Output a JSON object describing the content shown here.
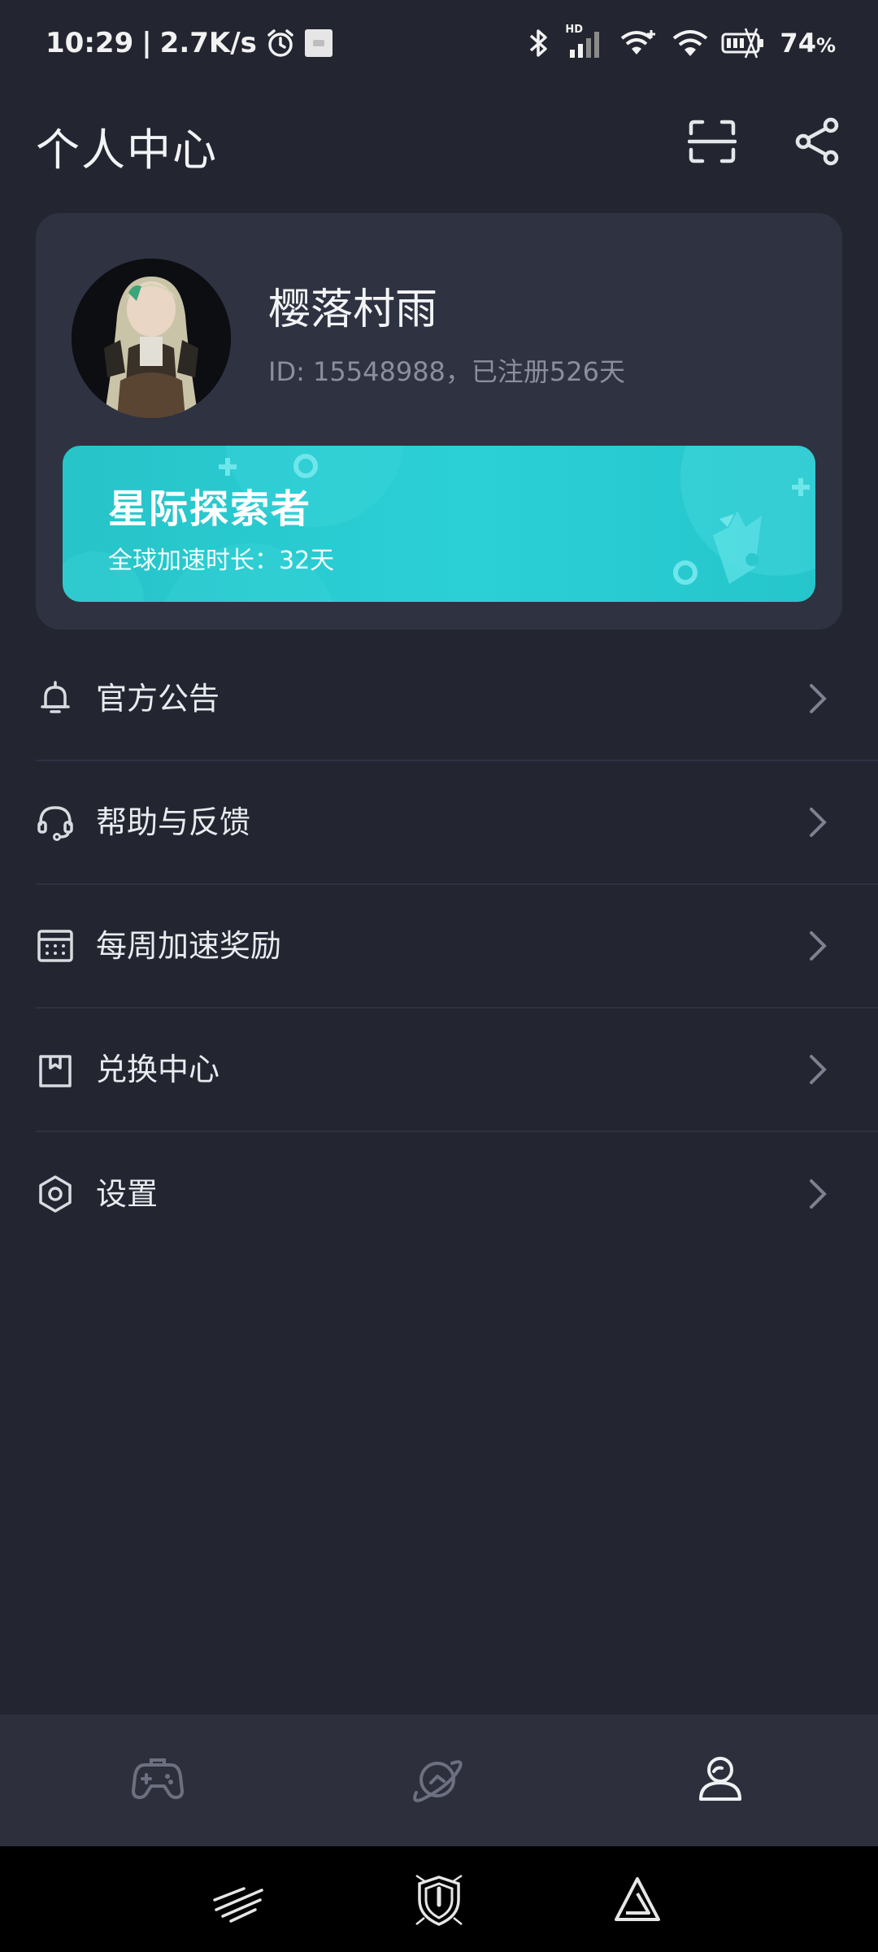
{
  "status_bar": {
    "time": "10:29",
    "separator": "|",
    "net_speed": "2.7K/s",
    "battery": "74",
    "battery_unit": "%",
    "signal_label": "HD"
  },
  "header": {
    "title": "个人中心"
  },
  "profile": {
    "name": "樱落村雨",
    "id_text": "ID: 15548988，已注册526天"
  },
  "vip": {
    "title": "星际探索者",
    "subtitle": "全球加速时长：32天"
  },
  "menu": [
    {
      "label": "官方公告",
      "icon": "bell-icon"
    },
    {
      "label": "帮助与反馈",
      "icon": "headset-icon"
    },
    {
      "label": "每周加速奖励",
      "icon": "calendar-icon"
    },
    {
      "label": "兑换中心",
      "icon": "gift-box-icon"
    },
    {
      "label": "设置",
      "icon": "settings-hexagon-icon"
    }
  ],
  "tabs": [
    {
      "name": "games",
      "icon": "gamepad-icon",
      "active": false
    },
    {
      "name": "explore",
      "icon": "planet-icon",
      "active": false
    },
    {
      "name": "profile",
      "icon": "user-icon",
      "active": true
    }
  ],
  "colors": {
    "background": "#232631",
    "card": "#2f3241",
    "vip_teal": "#2ad0d6",
    "tab_bar": "#2d303c",
    "text_primary": "#e9ebef",
    "text_secondary": "#8a8f9c"
  }
}
